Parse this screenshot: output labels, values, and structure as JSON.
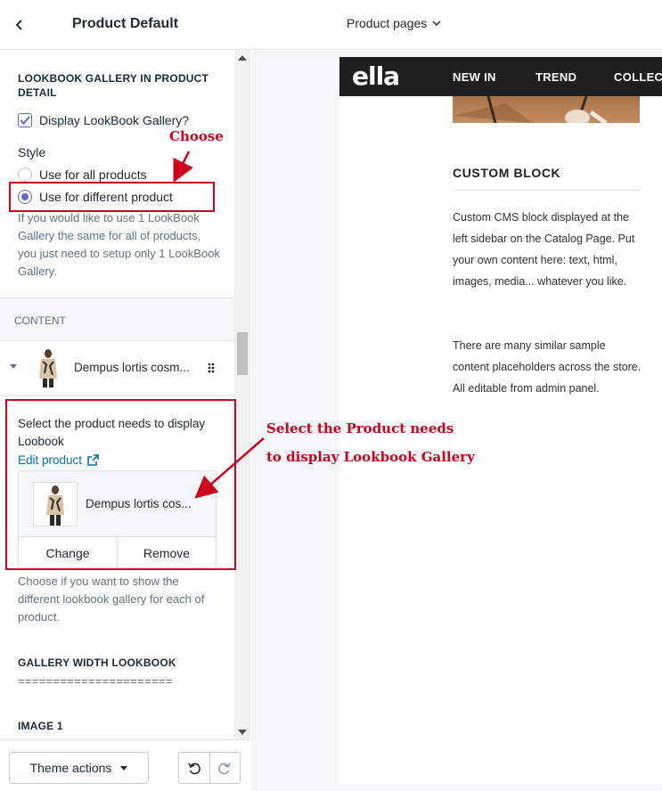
{
  "sidebar": {
    "title": "Product Default",
    "lookbook": {
      "heading": "LOOKBOOK GALLERY IN PRODUCT DETAIL",
      "checkbox_label": "Display LookBook Gallery?",
      "checkbox_checked": true,
      "style_label": "Style",
      "options": [
        "Use for all products",
        "Use for different product"
      ],
      "selected_option": "Use for different product",
      "help": "If you would like to use 1 LookBook Gallery the same for all of products, you just need to setup only 1 LookBook Gallery."
    },
    "content": {
      "heading": "CONTENT",
      "block_label": "Dempus lortis cosm..."
    },
    "block_settings": {
      "product_label": "Select the product needs to display Loobook",
      "edit_link": "Edit product",
      "product_name": "Dempus lortis cos...",
      "change_label": "Change",
      "remove_label": "Remove",
      "help": "Choose if you want to show the different lookbook gallery for each of product.",
      "gallery_heading": "GALLERY WIDTH LOOKBOOK",
      "gallery_rule": "======================",
      "image_heading": "IMAGE 1"
    },
    "footer": {
      "theme_actions": "Theme actions"
    }
  },
  "topbar": {
    "page_select": "Product pages"
  },
  "preview": {
    "logo": "ella",
    "nav": [
      "NEW IN",
      "TREND",
      "COLLEC"
    ],
    "custom_title": "CUSTOM BLOCK",
    "paragraph1": "Custom CMS block displayed at the left sidebar on the Catalog Page. Put your own content here: text, html, images, media... whatever you like.",
    "paragraph2": "There are many similar sample content placeholders across the store. All editable from admin panel."
  },
  "annotations": {
    "choose": "Choose",
    "select_line1": "Select the Product needs",
    "select_line2": "to display Lookbook Gallery",
    "color": "#d0021b"
  },
  "icons": [
    "chevron-left-icon",
    "checkmark-icon",
    "disclosure-caret-icon",
    "drag-handle-icon",
    "external-link-icon",
    "chevron-down-icon",
    "undo-icon",
    "redo-icon"
  ]
}
